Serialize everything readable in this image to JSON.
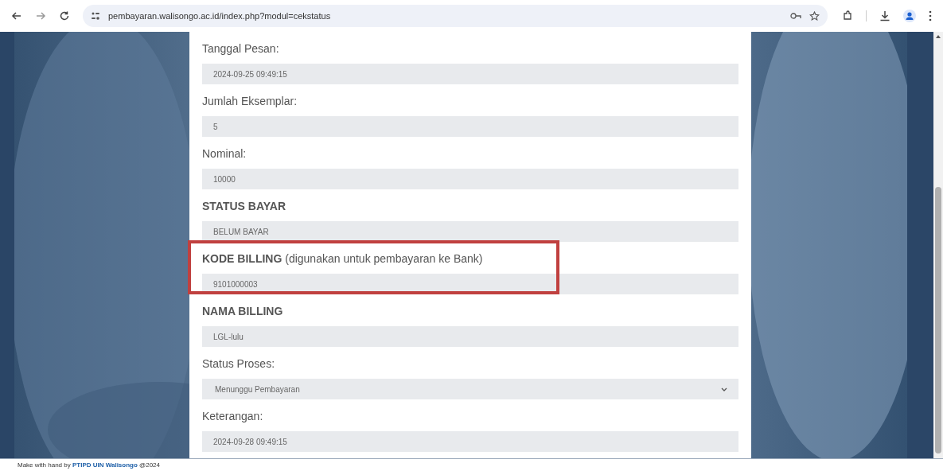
{
  "browser": {
    "url": "pembayaran.walisongo.ac.id/index.php?modul=cekstatus"
  },
  "fields": [
    {
      "label": "Tanggal Pesan:",
      "bold": false,
      "kind": "input",
      "value": "2024-09-25 09:49:15",
      "highlighted": false
    },
    {
      "label": "Jumlah Eksemplar:",
      "bold": false,
      "kind": "input",
      "value": "5",
      "highlighted": false
    },
    {
      "label": "Nominal:",
      "bold": false,
      "kind": "input",
      "value": "10000",
      "highlighted": false
    },
    {
      "label": "STATUS BAYAR",
      "bold": true,
      "kind": "input",
      "value": "BELUM BAYAR",
      "highlighted": false
    },
    {
      "label": "**KODE BILLING** (digunakan untuk pembayaran ke Bank)",
      "bold": false,
      "kind": "input",
      "value": "9101000003",
      "highlighted": true
    },
    {
      "label": "NAMA BILLING",
      "bold": true,
      "kind": "input",
      "value": "LGL-lulu",
      "highlighted": false
    },
    {
      "label": "Status Proses:",
      "bold": false,
      "kind": "select",
      "value": "Menunggu Pembayaran",
      "highlighted": false
    },
    {
      "label": "Keterangan:",
      "bold": false,
      "kind": "input",
      "value": "2024-09-28 09:49:15",
      "highlighted": false
    }
  ],
  "footer": {
    "text": "Make with hand by",
    "link": "PTIPD UIN Walisongo",
    "suffix": "@2024"
  }
}
